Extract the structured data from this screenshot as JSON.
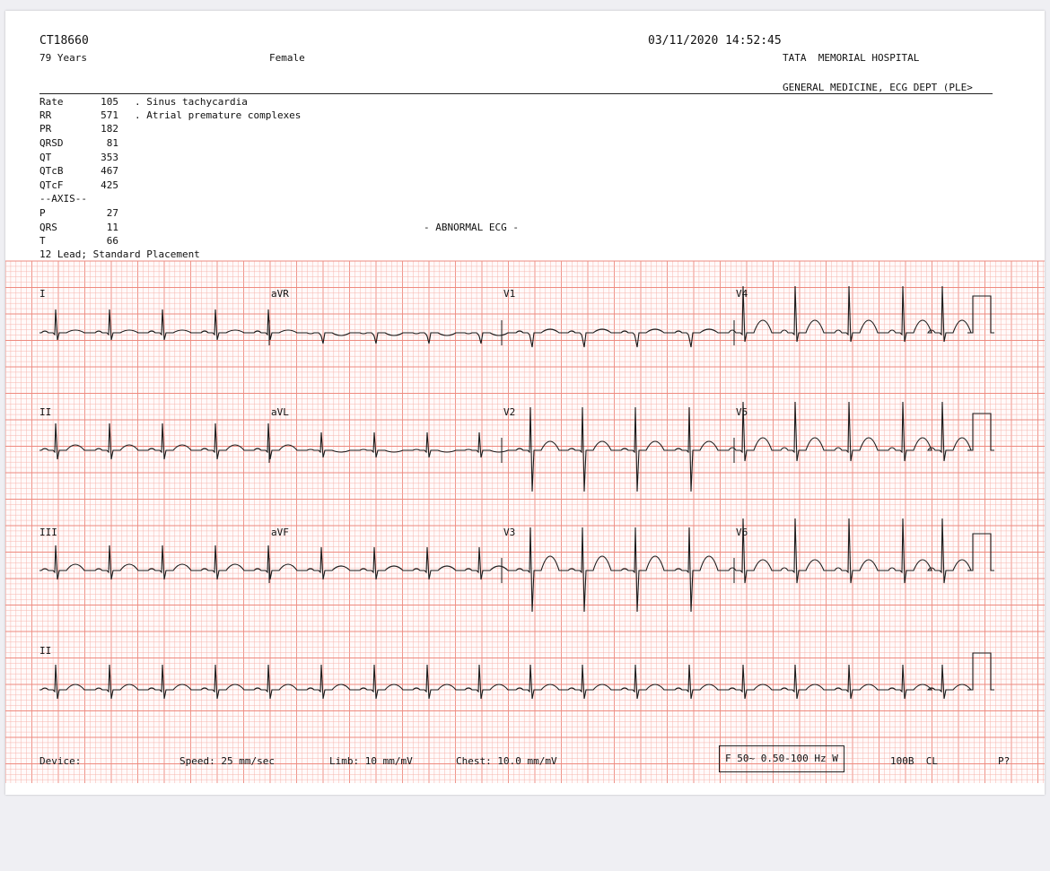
{
  "patient": {
    "id": "CT18660",
    "age": "79 Years",
    "sex": "Female",
    "datetime": "03/11/2020 14:52:45",
    "institution": "TATA  MEMORIAL HOSPITAL",
    "department": "GENERAL MEDICINE, ECG DEPT (PLE>"
  },
  "measurements": [
    {
      "label": "Rate",
      "value": "105"
    },
    {
      "label": "RR",
      "value": "571"
    },
    {
      "label": "PR",
      "value": "182"
    },
    {
      "label": "QRSD",
      "value": "81"
    },
    {
      "label": "QT",
      "value": "353"
    },
    {
      "label": "QTcB",
      "value": "467"
    },
    {
      "label": "QTcF",
      "value": "425"
    }
  ],
  "axis_header": "--AXIS--",
  "axis": [
    {
      "label": "P",
      "value": "27"
    },
    {
      "label": "QRS",
      "value": "11"
    },
    {
      "label": "T",
      "value": "66"
    }
  ],
  "interpretation": [
    ". Sinus tachycardia",
    ". Atrial premature complexes"
  ],
  "summary": "- ABNORMAL ECG -",
  "lead_setup": "12 Lead; Standard Placement",
  "leads": {
    "row1": [
      "I",
      "aVR",
      "V1",
      "V4"
    ],
    "row2": [
      "II",
      "aVL",
      "V2",
      "V5"
    ],
    "row3": [
      "III",
      "aVF",
      "V3",
      "V6"
    ],
    "rhythm": "II"
  },
  "footer": {
    "device": "Device:",
    "speed": "Speed: 25 mm/sec",
    "limb": "Limb: 10 mm/mV",
    "chest": "Chest: 10.0 mm/mV",
    "filter": "F 50~ 0.50-100 Hz W",
    "model": "100B  CL",
    "page": "P?"
  },
  "colors": {
    "grid_minor": "#f7b6ae",
    "grid_major": "#ee8b80",
    "trace": "#1a1a1a",
    "paper": "#ffffff"
  }
}
